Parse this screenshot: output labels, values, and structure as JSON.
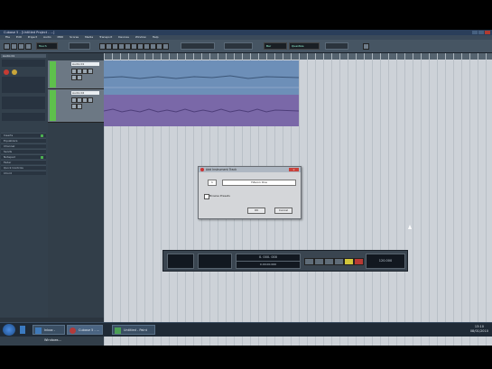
{
  "window": {
    "title": "Cubase 5 - [Untitled Project - ...]"
  },
  "menu": {
    "items": [
      "File",
      "Edit",
      "Project",
      "Audio",
      "MIDI",
      "Scores",
      "Media",
      "Transport",
      "Devices",
      "Window",
      "Help"
    ]
  },
  "toolbar": {
    "display_a": "Touch",
    "display_b": "Bar",
    "display_c": "Quantize"
  },
  "inspector": {
    "header": "Audio 01",
    "sections": [
      "Inserts",
      "Equalizers",
      "Channel",
      "Sends",
      "Notepad",
      "Fader",
      "Quick Controls",
      "Chord"
    ]
  },
  "tracks": [
    {
      "name": "Audio 01",
      "color": "#5ec04c"
    },
    {
      "name": "Audio 02",
      "color": "#5ec04c"
    }
  ],
  "events": [
    {
      "name": "Audio 01",
      "color": "#6d8fb8"
    },
    {
      "name": "Audio 02",
      "color": "#7a68a8"
    }
  ],
  "dialog": {
    "title": "Add Instrument Track",
    "count_label": "1",
    "instrument": "HALion One",
    "checkbox_label": "Browse Presets",
    "ok_label": "OK",
    "cancel_label": "Cancel"
  },
  "transport": {
    "position_primary": "0. 000. 000",
    "position_secondary": "0.00.00.000",
    "tempo": "120.000"
  },
  "taskbar": {
    "tasks": [
      {
        "label": "Inbox - Windows...",
        "icon": "mail-icon",
        "color": "#3f79b8"
      },
      {
        "label": "Cubase 5 - ...",
        "icon": "cubase-icon",
        "color": "#b23a3a"
      },
      {
        "label": "Untitled - Paint",
        "icon": "paint-icon",
        "color": "#4b9f55"
      }
    ],
    "clock_time": "13:10",
    "clock_date": "08/01/2010"
  }
}
